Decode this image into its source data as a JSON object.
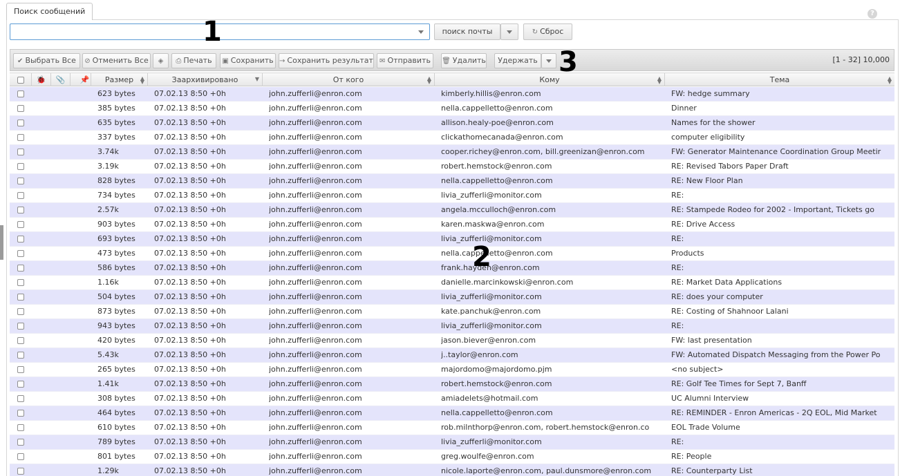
{
  "tab": {
    "label": "Поиск сообщений"
  },
  "search": {
    "value": "",
    "placeholder": "",
    "search_button": "поиск почты",
    "reset_button": "Сброс"
  },
  "toolbar": {
    "select_all": "Выбрать Все",
    "deselect_all": "Отменить Все",
    "print": "Печать",
    "save": "Сохранить",
    "save_result": "Сохранить результат",
    "send": "Отправить",
    "delete": "Удалить",
    "hold": "Удержать",
    "counter": "[1 - 32] 10,000"
  },
  "columns": {
    "size": "Размер",
    "archived": "Заархивировано",
    "from": "От кого",
    "to": "Кому",
    "subject": "Тема"
  },
  "markers": [
    "1",
    "2",
    "3"
  ],
  "rows": [
    {
      "size": "623 bytes",
      "archived": "07.02.13 8:50 +0h",
      "from": "john.zufferli@enron.com",
      "to": "kimberly.hillis@enron.com",
      "subject": "FW: hedge summary"
    },
    {
      "size": "385 bytes",
      "archived": "07.02.13 8:50 +0h",
      "from": "john.zufferli@enron.com",
      "to": "nella.cappelletto@enron.com",
      "subject": "Dinner"
    },
    {
      "size": "635 bytes",
      "archived": "07.02.13 8:50 +0h",
      "from": "john.zufferli@enron.com",
      "to": "allison.healy-poe@enron.com",
      "subject": "Names for the shower"
    },
    {
      "size": "337 bytes",
      "archived": "07.02.13 8:50 +0h",
      "from": "john.zufferli@enron.com",
      "to": "clickathomecanada@enron.com",
      "subject": "computer eligibility"
    },
    {
      "size": "3.74k",
      "archived": "07.02.13 8:50 +0h",
      "from": "john.zufferli@enron.com",
      "to": "cooper.richey@enron.com, bill.greenizan@enron.com",
      "subject": "FW: Generator Maintenance Coordination Group Meetir"
    },
    {
      "size": "3.19k",
      "archived": "07.02.13 8:50 +0h",
      "from": "john.zufferli@enron.com",
      "to": "robert.hemstock@enron.com",
      "subject": "RE: Revised Tabors Paper Draft"
    },
    {
      "size": "828 bytes",
      "archived": "07.02.13 8:50 +0h",
      "from": "john.zufferli@enron.com",
      "to": "nella.cappelletto@enron.com",
      "subject": "RE: New Floor Plan"
    },
    {
      "size": "734 bytes",
      "archived": "07.02.13 8:50 +0h",
      "from": "john.zufferli@enron.com",
      "to": "livia_zufferli@monitor.com",
      "subject": "RE:"
    },
    {
      "size": "2.57k",
      "archived": "07.02.13 8:50 +0h",
      "from": "john.zufferli@enron.com",
      "to": "angela.mcculloch@enron.com",
      "subject": "RE: Stampede Rodeo for 2002 - Important, Tickets go"
    },
    {
      "size": "903 bytes",
      "archived": "07.02.13 8:50 +0h",
      "from": "john.zufferli@enron.com",
      "to": "karen.maskwa@enron.com",
      "subject": "RE: Drive Access"
    },
    {
      "size": "693 bytes",
      "archived": "07.02.13 8:50 +0h",
      "from": "john.zufferli@enron.com",
      "to": "livia_zufferli@monitor.com",
      "subject": "RE:"
    },
    {
      "size": "473 bytes",
      "archived": "07.02.13 8:50 +0h",
      "from": "john.zufferli@enron.com",
      "to": "nella.cappelletto@enron.com",
      "subject": "Products"
    },
    {
      "size": "586 bytes",
      "archived": "07.02.13 8:50 +0h",
      "from": "john.zufferli@enron.com",
      "to": "frank.hayden@enron.com",
      "subject": "RE:"
    },
    {
      "size": "1.16k",
      "archived": "07.02.13 8:50 +0h",
      "from": "john.zufferli@enron.com",
      "to": "danielle.marcinkowski@enron.com",
      "subject": "RE: Market Data Applications"
    },
    {
      "size": "504 bytes",
      "archived": "07.02.13 8:50 +0h",
      "from": "john.zufferli@enron.com",
      "to": "livia_zufferli@monitor.com",
      "subject": "RE: does your computer"
    },
    {
      "size": "873 bytes",
      "archived": "07.02.13 8:50 +0h",
      "from": "john.zufferli@enron.com",
      "to": "kate.panchuk@enron.com",
      "subject": "RE: Costing of Shahnoor Lalani"
    },
    {
      "size": "943 bytes",
      "archived": "07.02.13 8:50 +0h",
      "from": "john.zufferli@enron.com",
      "to": "livia_zufferli@monitor.com",
      "subject": "RE:"
    },
    {
      "size": "420 bytes",
      "archived": "07.02.13 8:50 +0h",
      "from": "john.zufferli@enron.com",
      "to": "jason.biever@enron.com",
      "subject": "FW: last presentation"
    },
    {
      "size": "5.43k",
      "archived": "07.02.13 8:50 +0h",
      "from": "john.zufferli@enron.com",
      "to": "j..taylor@enron.com",
      "subject": "FW: Automated Dispatch Messaging from the Power Po"
    },
    {
      "size": "265 bytes",
      "archived": "07.02.13 8:50 +0h",
      "from": "john.zufferli@enron.com",
      "to": "majordomo@majordomo.pjm",
      "subject": "<no subject>"
    },
    {
      "size": "1.41k",
      "archived": "07.02.13 8:50 +0h",
      "from": "john.zufferli@enron.com",
      "to": "robert.hemstock@enron.com",
      "subject": "RE: Golf Tee Times for Sept 7, Banff"
    },
    {
      "size": "308 bytes",
      "archived": "07.02.13 8:50 +0h",
      "from": "john.zufferli@enron.com",
      "to": "amiadelets@hotmail.com",
      "subject": "UC Alumni Interview"
    },
    {
      "size": "464 bytes",
      "archived": "07.02.13 8:50 +0h",
      "from": "john.zufferli@enron.com",
      "to": "nella.cappelletto@enron.com",
      "subject": "RE: REMINDER - Enron Americas - 2Q EOL, Mid Market"
    },
    {
      "size": "610 bytes",
      "archived": "07.02.13 8:50 +0h",
      "from": "john.zufferli@enron.com",
      "to": "rob.milnthorp@enron.com, robert.hemstock@enron.co",
      "subject": "EOL Trade Volume"
    },
    {
      "size": "789 bytes",
      "archived": "07.02.13 8:50 +0h",
      "from": "john.zufferli@enron.com",
      "to": "livia_zufferli@monitor.com",
      "subject": "RE:"
    },
    {
      "size": "801 bytes",
      "archived": "07.02.13 8:50 +0h",
      "from": "john.zufferli@enron.com",
      "to": "greg.woulfe@enron.com",
      "subject": "RE: People"
    },
    {
      "size": "1.29k",
      "archived": "07.02.13 8:50 +0h",
      "from": "john.zufferli@enron.com",
      "to": "nicole.laporte@enron.com, paul.dunsmore@enron.com",
      "subject": "RE: Counterparty List"
    }
  ]
}
